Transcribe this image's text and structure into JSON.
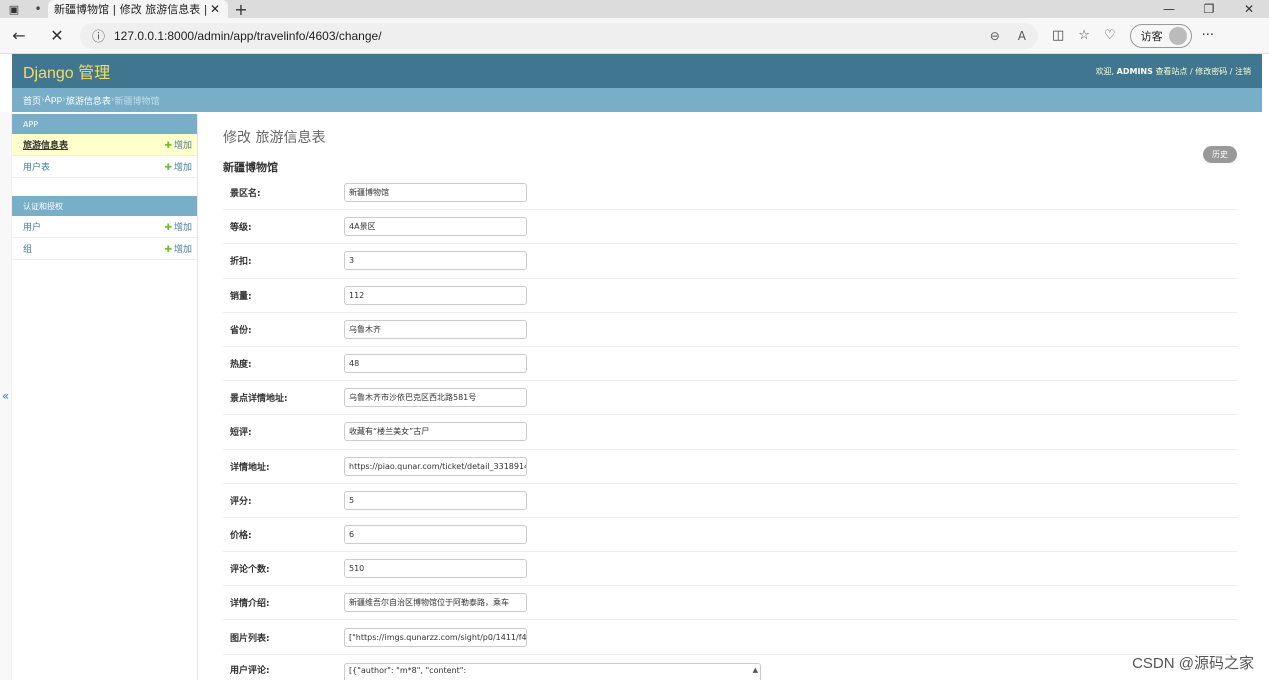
{
  "browser": {
    "tab_title": "新疆博物馆 | 修改 旅游信息表 | D",
    "url": "127.0.0.1:8000/admin/app/travelinfo/4603/change/",
    "visitor_label": "访客"
  },
  "header": {
    "brand": "Django 管理",
    "welcome": "欢迎,",
    "username": "ADMINS",
    "links": "查看站点 / 修改密码 / 注销"
  },
  "breadcrumbs": {
    "home": "首页",
    "app": "App",
    "model": "旅游信息表",
    "current": "新疆博物馆",
    "sep": " › "
  },
  "sidebar": {
    "modules": [
      {
        "caption": "APP",
        "items": [
          {
            "label": "旅游信息表",
            "add": "增加"
          },
          {
            "label": "用户表",
            "add": "增加"
          }
        ]
      },
      {
        "caption": "认证和授权",
        "items": [
          {
            "label": "用户",
            "add": "增加"
          },
          {
            "label": "组",
            "add": "增加"
          }
        ]
      }
    ],
    "toggle": "«"
  },
  "content": {
    "title": "修改 旅游信息表",
    "object_title": "新疆博物馆",
    "history_button": "历史"
  },
  "form": {
    "fields": [
      {
        "label": "景区名:",
        "value": "新疆博物馆"
      },
      {
        "label": "等级:",
        "value": "4A景区"
      },
      {
        "label": "折扣:",
        "value": "3"
      },
      {
        "label": "销量:",
        "value": "112"
      },
      {
        "label": "省份:",
        "value": "乌鲁木齐"
      },
      {
        "label": "热度:",
        "value": "48"
      },
      {
        "label": "景点详情地址:",
        "value": "乌鲁木齐市沙依巴克区西北路581号"
      },
      {
        "label": "短评:",
        "value": "收藏有“楼兰美女”古尸"
      },
      {
        "label": "详情地址:",
        "value": "https://piao.qunar.com/ticket/detail_3318914"
      },
      {
        "label": "评分:",
        "value": "5"
      },
      {
        "label": "价格:",
        "value": "6"
      },
      {
        "label": "评论个数:",
        "value": "510"
      },
      {
        "label": "详情介绍:",
        "value": "新疆维吾尔自治区博物馆位于阿勒泰路，乘车"
      },
      {
        "label": "图片列表:",
        "value": "[\"https://imgs.qunarzz.com/sight/p0/1411/f4"
      },
      {
        "label": "用户评论:",
        "value": "[{\"author\": \"m*8\", \"content\":"
      }
    ]
  },
  "watermark": "CSDN @源码之家"
}
